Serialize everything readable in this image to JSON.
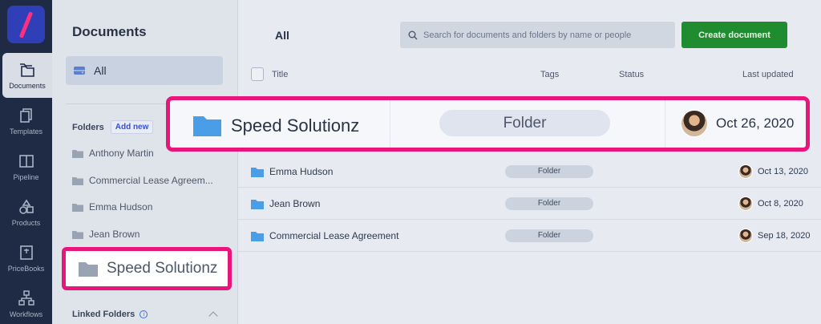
{
  "rail": {
    "items": [
      {
        "label": "Documents",
        "icon": "folders-icon",
        "active": true
      },
      {
        "label": "Templates",
        "icon": "templates-icon"
      },
      {
        "label": "Pipeline",
        "icon": "pipeline-icon"
      },
      {
        "label": "Products",
        "icon": "products-icon"
      },
      {
        "label": "PriceBooks",
        "icon": "pricebooks-icon"
      },
      {
        "label": "Workflows",
        "icon": "workflows-icon"
      }
    ]
  },
  "docpanel": {
    "title": "Documents",
    "all_label": "All",
    "folders_label": "Folders",
    "add_new_label": "Add new",
    "folders": [
      "Anthony Martin",
      "Commercial Lease Agreem...",
      "Emma Hudson",
      "Jean Brown"
    ],
    "highlighted_folder": "Speed Solutionz",
    "linked_label": "Linked Folders",
    "info_glyph": "i"
  },
  "main": {
    "title": "All",
    "search_placeholder": "Search for documents and folders by name or people",
    "create_label": "Create document",
    "columns": {
      "title": "Title",
      "tags": "Tags",
      "status": "Status",
      "updated": "Last updated"
    },
    "highlighted_row": {
      "name": "Speed Solutionz",
      "tag": "Folder",
      "date": "Oct 26, 2020"
    },
    "rows": [
      {
        "name": "Emma Hudson",
        "tag": "Folder",
        "date": "Oct 13, 2020"
      },
      {
        "name": "Jean Brown",
        "tag": "Folder",
        "date": "Oct 8, 2020"
      },
      {
        "name": "Commercial Lease Agreement",
        "tag": "Folder",
        "date": "Sep 18, 2020"
      }
    ]
  },
  "colors": {
    "highlight": "#e8157b",
    "primary_button": "#1e8c2f",
    "folder_blue": "#4a9ee8",
    "rail": "#1f2a44"
  }
}
